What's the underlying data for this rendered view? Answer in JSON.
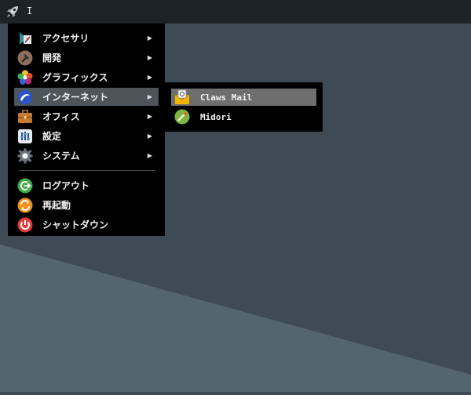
{
  "taskbar": {
    "launcher_icon": "rocket-icon",
    "label": "I"
  },
  "menu": {
    "items": [
      {
        "label": "アクセサリ",
        "icon": "accessories-icon",
        "has_submenu": true
      },
      {
        "label": "開発",
        "icon": "development-icon",
        "has_submenu": true
      },
      {
        "label": "グラフィックス",
        "icon": "graphics-icon",
        "has_submenu": true
      },
      {
        "label": "インターネット",
        "icon": "internet-icon",
        "has_submenu": true,
        "active": true
      },
      {
        "label": "オフィス",
        "icon": "office-icon",
        "has_submenu": true
      },
      {
        "label": "設定",
        "icon": "settings-icon",
        "has_submenu": true
      },
      {
        "label": "システム",
        "icon": "system-icon",
        "has_submenu": true
      }
    ],
    "actions": [
      {
        "label": "ログアウト",
        "icon": "logout-icon"
      },
      {
        "label": "再起動",
        "icon": "reboot-icon"
      },
      {
        "label": "シャットダウン",
        "icon": "shutdown-icon"
      }
    ],
    "arrow": "▶"
  },
  "submenu": {
    "items": [
      {
        "label": "Claws Mail",
        "icon": "claws-mail-icon",
        "active": true
      },
      {
        "label": "Midori",
        "icon": "midori-icon"
      }
    ]
  },
  "colors": {
    "taskbar": "#1c2328",
    "menu_bg": "#000000",
    "active_item": "#4d555b",
    "active_subitem": "#6e6e6e"
  }
}
